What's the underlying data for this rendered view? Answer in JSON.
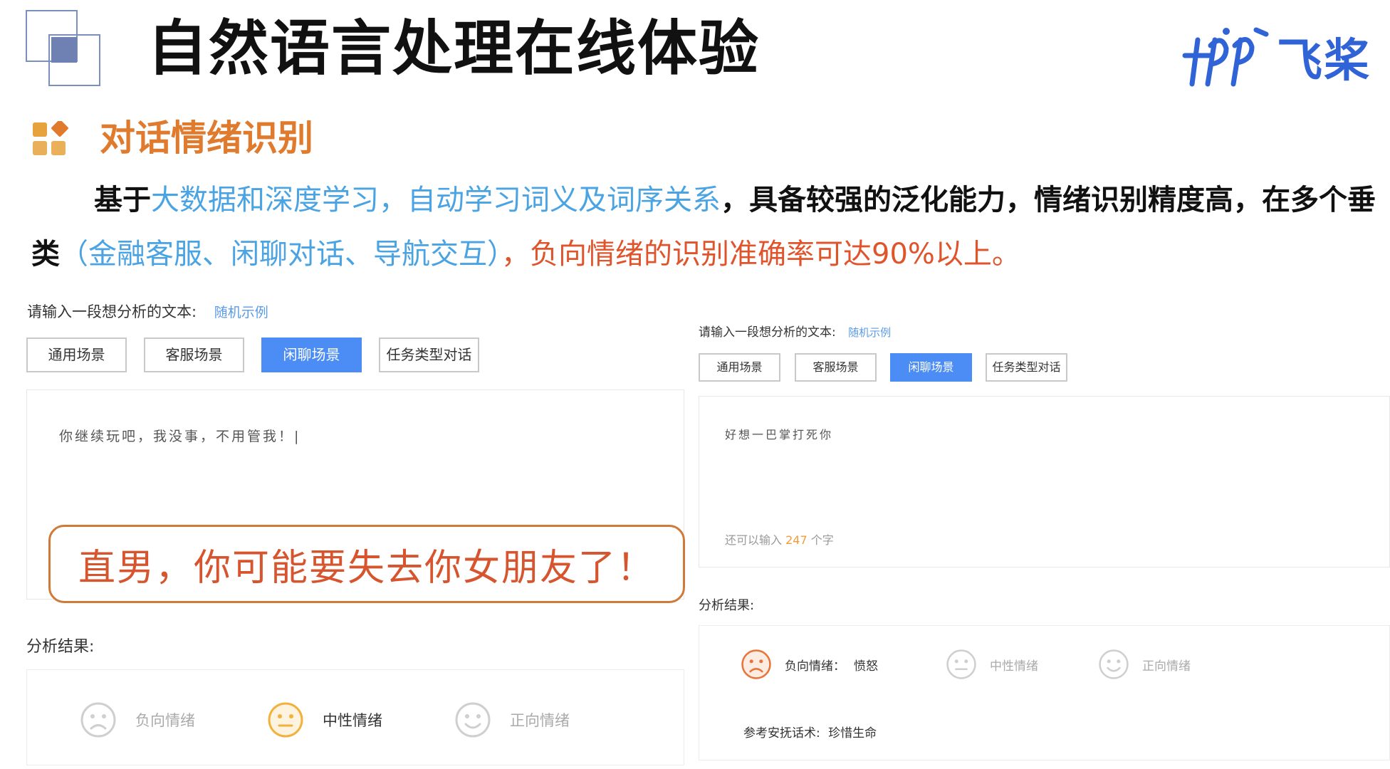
{
  "header": {
    "title": "自然语言处理在线体验",
    "logo_text": "飞桨"
  },
  "section": {
    "title": "对话情绪识别",
    "desc_part1": "基于",
    "desc_blue1": "大数据和深度学习，自动学习词义及词序关系",
    "desc_part2": "，具备较强的泛化能力，情绪识别精度高，在多个垂类",
    "desc_blue2": "（金融客服、闲聊对话、导航交互）",
    "desc_red": "，负向情绪的识别准确率可达90%以上。"
  },
  "left_panel": {
    "prompt": "请输入一段想分析的文本:",
    "random_link": "随机示例",
    "tabs": [
      "通用场景",
      "客服场景",
      "闲聊场景",
      "任务类型对话"
    ],
    "active_tab": 2,
    "input_text": "你继续玩吧，我没事，不用管我！|",
    "callout": "直男，你可能要失去你女朋友了！",
    "result_label": "分析结果:",
    "emotions": [
      "负向情绪",
      "中性情绪",
      "正向情绪"
    ],
    "selected_emotion": 1
  },
  "right_panel": {
    "prompt": "请输入一段想分析的文本:",
    "random_link": "随机示例",
    "tabs": [
      "通用场景",
      "客服场景",
      "闲聊场景",
      "任务类型对话"
    ],
    "active_tab": 2,
    "input_text": "好想一巴掌打死你",
    "counter_prefix": "还可以输入",
    "counter_value": "247",
    "counter_suffix": "个字",
    "result_label": "分析结果:",
    "negative_label": "负向情绪：",
    "negative_value": "愤怒",
    "emotions": [
      "负向情绪",
      "中性情绪",
      "正向情绪"
    ],
    "selected_emotion": 0,
    "comfort_label": "参考安抚话术:",
    "comfort_value": "珍惜生命"
  },
  "colors": {
    "accent_blue": "#4b8cf5",
    "section_orange": "#e07b2e",
    "callout_red": "#d7552e",
    "negative_face": "#e8743a",
    "neutral_face": "#f2b13c",
    "inactive_face": "#cfcfcf"
  },
  "icons": [
    "square-deco-icon",
    "grid-blocks-icon",
    "paddle-logo-icon",
    "sad-face-icon",
    "neutral-face-icon",
    "happy-face-icon"
  ]
}
